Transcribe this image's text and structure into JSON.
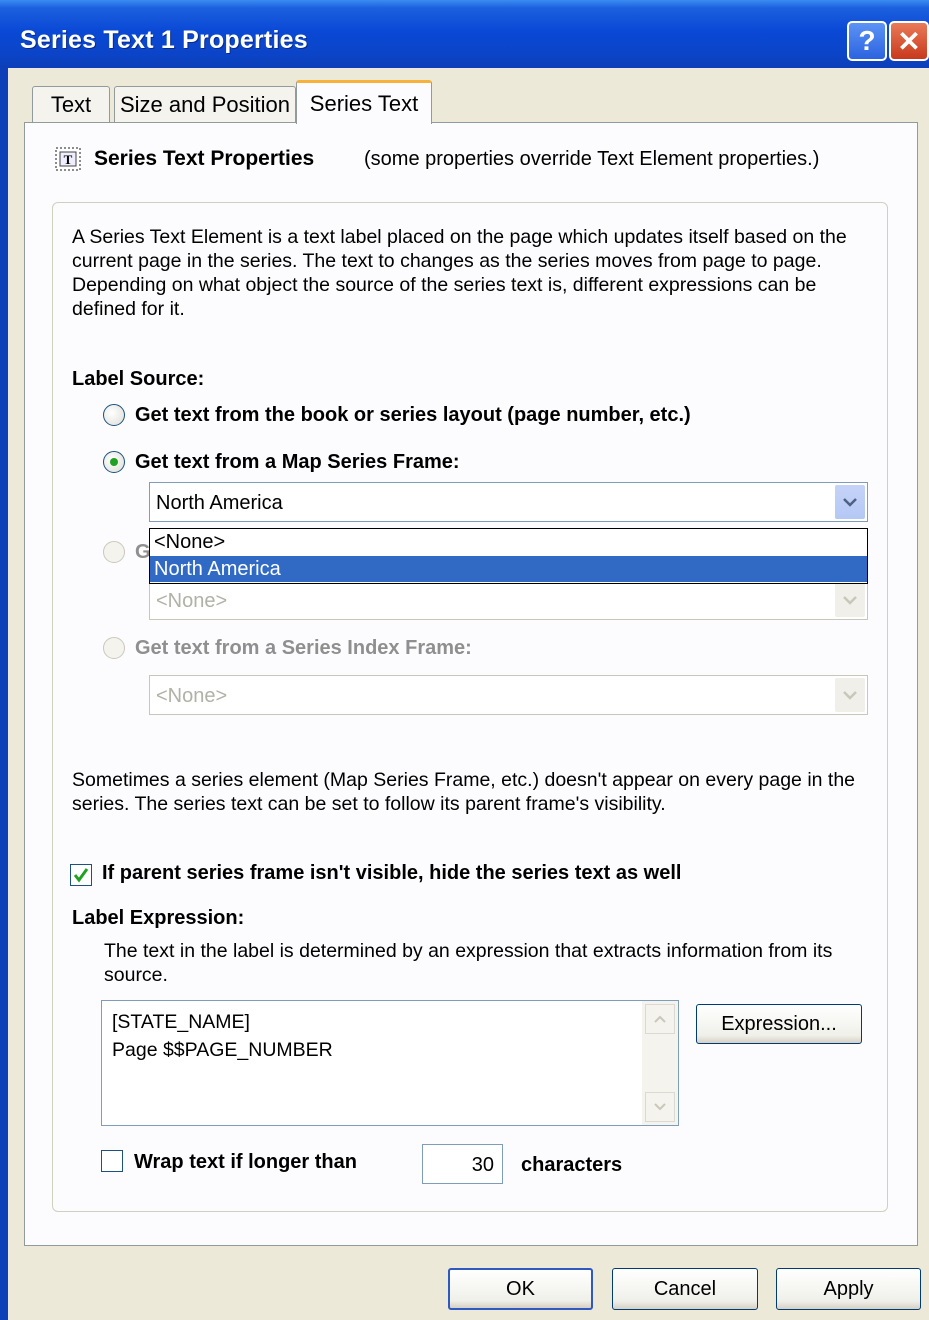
{
  "window": {
    "title": "Series Text 1 Properties",
    "help_icon": "?",
    "close_icon": "✕"
  },
  "tabs": [
    {
      "label": "Text"
    },
    {
      "label": "Size and Position"
    },
    {
      "label": "Series Text",
      "active": true
    }
  ],
  "panel": {
    "heading": "Series Text Properties",
    "note": "(some properties override Text Element properties.)",
    "description": "A Series Text Element is a text label placed on the page which updates itself based on the current page in the series.  The text to changes as the series moves from page to page.  Depending on what object the source of the series text is, different expressions can be defined for it.",
    "label_source": {
      "heading": "Label Source:",
      "options": [
        {
          "label": "Get text from the book or series layout (page number, etc.)",
          "selected": false,
          "enabled": true
        },
        {
          "label": "Get text from a Map Series Frame:",
          "selected": true,
          "enabled": true
        },
        {
          "label": "G",
          "selected": false,
          "enabled": false
        },
        {
          "label": "Get text from a Series Index Frame:",
          "selected": false,
          "enabled": false
        }
      ],
      "map_frame_combo": {
        "value": "North America",
        "dropdown": [
          "<None>",
          "North America"
        ],
        "highlighted": "North America"
      },
      "combo3_value": "<None>",
      "combo4_value": "<None>"
    },
    "visibility_description": "Sometimes a series element (Map Series Frame, etc.) doesn't appear on every page in the series.  The series text can be set to follow its parent frame's visibility.",
    "hide_checkbox": {
      "label": "If parent series frame isn't visible, hide the series text as well",
      "checked": true
    },
    "label_expression": {
      "heading": "Label Expression:",
      "description": "The text in the label is determined by an expression that extracts information from its source.",
      "lines": [
        "[STATE_NAME]",
        "Page $$PAGE_NUMBER"
      ],
      "button_label": "Expression..."
    },
    "wrap": {
      "label": "Wrap text if longer than",
      "checked": false,
      "value": "30",
      "suffix": "characters"
    }
  },
  "footer": {
    "ok_label": "OK",
    "cancel_label": "Cancel",
    "apply_label": "Apply"
  },
  "colors": {
    "titlebar": "#0a49d6",
    "selection": "#316ac5",
    "active_tab_accent": "#f7b23b",
    "radio_dot": "#21a121",
    "check_mark": "#21a121"
  }
}
